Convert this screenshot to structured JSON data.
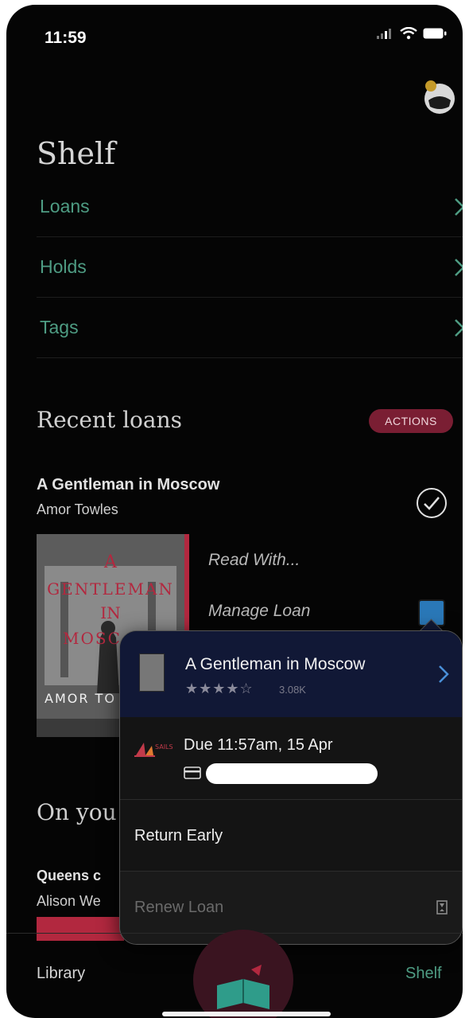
{
  "status": {
    "time": "11:59"
  },
  "page_title": "Shelf",
  "nav": [
    {
      "label": "Loans"
    },
    {
      "label": "Holds"
    },
    {
      "label": "Tags"
    }
  ],
  "recent": {
    "title": "Recent loans",
    "actions_label": "ACTIONS",
    "book": {
      "title": "A Gentleman in Moscow",
      "author": "Amor Towles",
      "menu": [
        "Read With...",
        "Manage Loan"
      ],
      "cover": {
        "word1": "A",
        "word2": "GENTLEMAN",
        "word3": "IN",
        "word4": "MOSC",
        "author": "AMOR TO"
      }
    }
  },
  "on_your": {
    "title": "On you",
    "book_title": "Queens c",
    "book_author": "Alison We"
  },
  "popover": {
    "title": "A Gentleman in Moscow",
    "stars": "★★★★☆",
    "rating_count": "3.08K",
    "due": "Due 11:57am, 15 Apr",
    "return_label": "Return Early",
    "renew_label": "Renew Loan",
    "logo_text": "SAILS"
  },
  "tabs": {
    "library": "Library",
    "shelf": "Shelf"
  },
  "colors": {
    "accent_green": "#4e9c83",
    "accent_red": "#b2283f",
    "popover_header": "#111836"
  }
}
